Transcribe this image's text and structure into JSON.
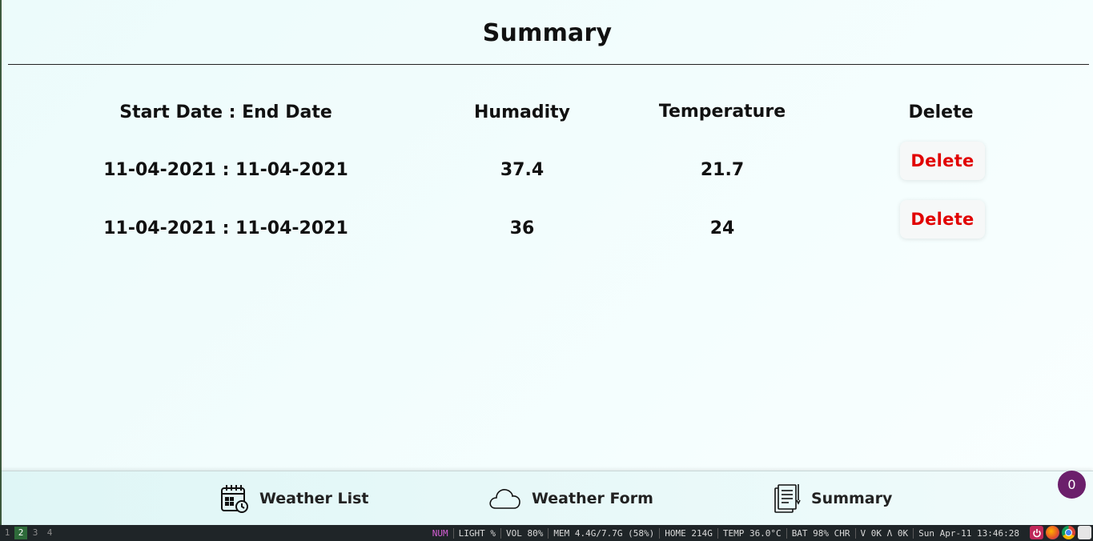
{
  "page": {
    "title": "Summary"
  },
  "table": {
    "headers": [
      "Start Date : End Date",
      "Humadity",
      "Temperature",
      "Delete"
    ],
    "rows": [
      {
        "dates": "11-04-2021 : 11-04-2021",
        "humidity": "37.4",
        "temperature": "21.7",
        "delete_label": "Delete"
      },
      {
        "dates": "11-04-2021 : 11-04-2021",
        "humidity": "36",
        "temperature": "24",
        "delete_label": "Delete"
      }
    ]
  },
  "nav": {
    "items": [
      {
        "label": "Weather List",
        "icon": "calendar-clock-icon"
      },
      {
        "label": "Weather Form",
        "icon": "cloud-icon"
      },
      {
        "label": "Summary",
        "icon": "document-icon"
      }
    ],
    "badge": "0"
  },
  "taskbar": {
    "workspaces": [
      "1",
      "2",
      "3",
      "4"
    ],
    "active_workspace": "2",
    "status": [
      "NUM",
      "LIGHT %",
      "VOL 80%",
      "MEM 4.4G/7.7G (58%)",
      "HOME 214G",
      "TEMP 36.0°C",
      "BAT 98% CHR",
      "V 0K Λ 0K",
      "Sun Apr-11 13:46:28"
    ],
    "tray_icons": [
      "power-icon",
      "firefox-icon",
      "chrome-icon",
      "screen-icon"
    ]
  },
  "colors": {
    "delete": "#e10000",
    "badge": "#6b1f6b",
    "workspace_active": "#2e6b3a"
  }
}
